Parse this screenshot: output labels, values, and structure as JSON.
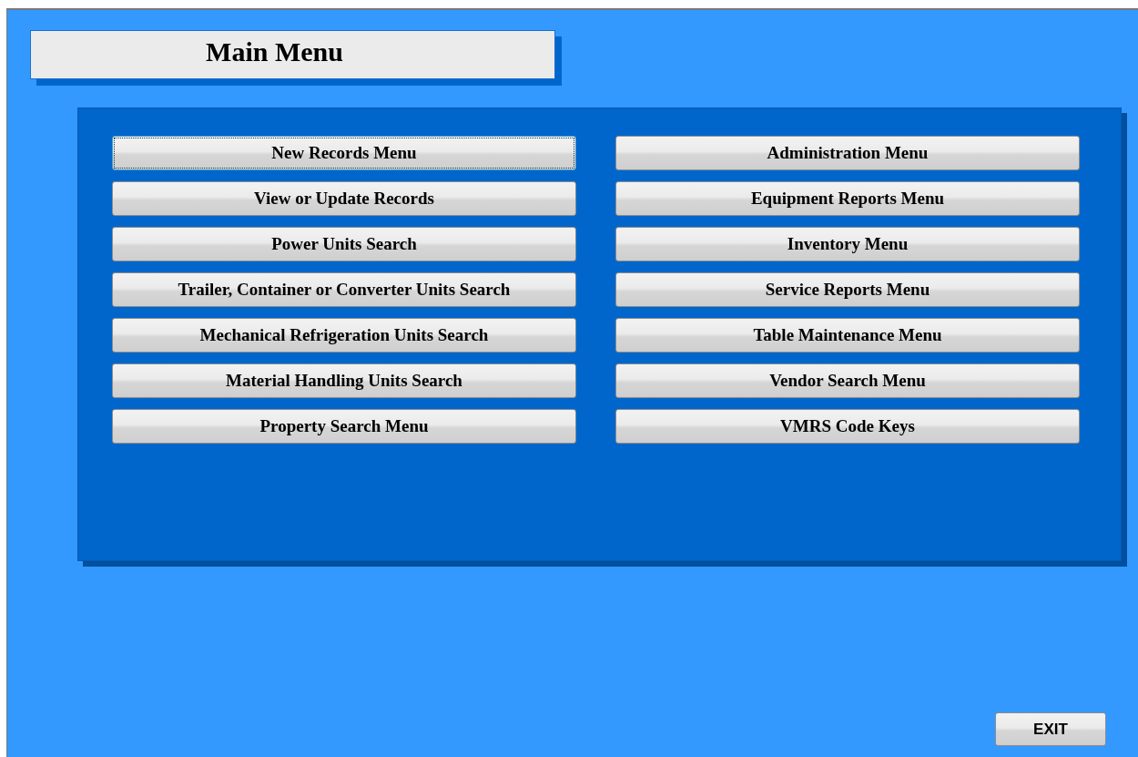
{
  "title": "Main Menu",
  "menu_columns": [
    [
      {
        "label": "New Records Menu",
        "focused": true
      },
      {
        "label": "View or Update Records",
        "focused": false
      },
      {
        "label": "Power Units Search",
        "focused": false
      },
      {
        "label": "Trailer, Container or Converter Units Search",
        "focused": false
      },
      {
        "label": "Mechanical Refrigeration Units Search",
        "focused": false
      },
      {
        "label": "Material Handling Units Search",
        "focused": false
      },
      {
        "label": "Property Search Menu",
        "focused": false
      }
    ],
    [
      {
        "label": "Administration Menu",
        "focused": false
      },
      {
        "label": "Equipment Reports Menu",
        "focused": false
      },
      {
        "label": "Inventory Menu",
        "focused": false
      },
      {
        "label": "Service Reports Menu",
        "focused": false
      },
      {
        "label": "Table Maintenance Menu",
        "focused": false
      },
      {
        "label": "Vendor Search Menu",
        "focused": false
      },
      {
        "label": "VMRS Code Keys",
        "focused": false
      }
    ]
  ],
  "exit_button": "EXIT"
}
